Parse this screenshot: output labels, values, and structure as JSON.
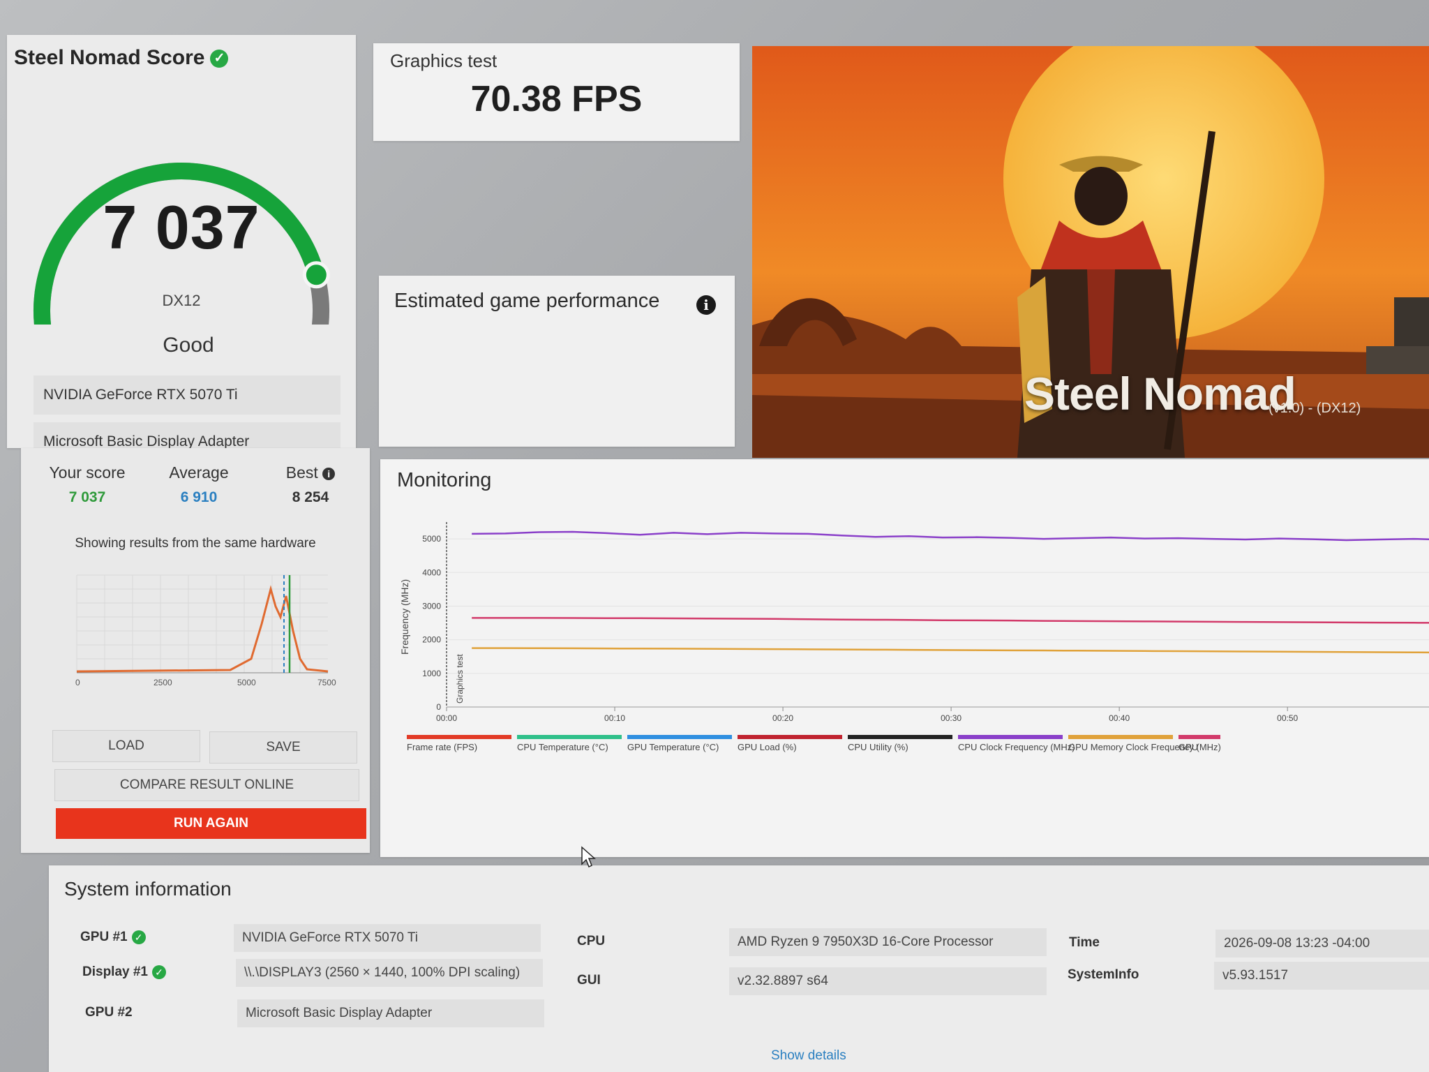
{
  "score": {
    "title": "Steel Nomad Score",
    "value": "7 037",
    "api": "DX12",
    "rating": "Good",
    "gauge_fraction": 0.86,
    "hardware": [
      "NVIDIA GeForce RTX 5070 Ti",
      "Microsoft Basic Display Adapter"
    ]
  },
  "compare": {
    "your_label": "Your score",
    "your_value": "7 037",
    "avg_label": "Average",
    "avg_value": "6 910",
    "best_label": "Best",
    "best_value": "8 254",
    "note": "Showing results from the same hardware",
    "axis_ticks": [
      "0",
      "2500",
      "5000",
      "7500"
    ]
  },
  "buttons": {
    "load": "LOAD",
    "save": "SAVE",
    "compare": "COMPARE RESULT ONLINE",
    "run_again": "RUN AGAIN"
  },
  "graphics_test": {
    "label": "Graphics test",
    "value": "70.38 FPS"
  },
  "estimated": {
    "title": "Estimated game performance"
  },
  "hero": {
    "title": "Steel Nomad",
    "version": "(v1.0) - (DX12)"
  },
  "monitoring": {
    "title": "Monitoring",
    "y_axis_label": "Frequency (MHz)",
    "marker_label": "Graphics test",
    "y_ticks": [
      "0",
      "1000",
      "2000",
      "3000",
      "4000",
      "5000"
    ],
    "x_ticks": [
      "00:00",
      "00:10",
      "00:20",
      "00:30",
      "00:40",
      "00:50"
    ],
    "legend": [
      {
        "label": "Frame rate (FPS)",
        "color": "#e23a26"
      },
      {
        "label": "CPU Temperature (°C)",
        "color": "#2fc08a"
      },
      {
        "label": "GPU Temperature (°C)",
        "color": "#2f8fe0"
      },
      {
        "label": "GPU Load (%)",
        "color": "#c0232f"
      },
      {
        "label": "CPU Utility (%)",
        "color": "#222222"
      },
      {
        "label": "CPU Clock Frequency (MHz)",
        "color": "#8a3fc9"
      },
      {
        "label": "GPU Memory Clock Frequency (MHz)",
        "color": "#e0a23a"
      },
      {
        "label": "GPU",
        "color": "#d23a6a"
      }
    ]
  },
  "chart_data": {
    "type": "line",
    "xlabel": "",
    "ylabel": "Frequency (MHz)",
    "ylim": [
      0,
      5500
    ],
    "x": [
      0,
      2,
      4,
      6,
      8,
      10,
      12,
      14,
      16,
      18,
      20,
      22,
      24,
      26,
      28,
      30,
      32,
      34,
      36,
      38,
      40,
      42,
      44,
      46,
      48,
      50,
      52,
      54,
      56,
      58
    ],
    "series": [
      {
        "name": "CPU Clock Frequency (MHz)",
        "color": "#8a3fc9",
        "values": [
          5150,
          5160,
          5200,
          5210,
          5170,
          5120,
          5180,
          5140,
          5180,
          5160,
          5150,
          5100,
          5060,
          5080,
          5040,
          5050,
          5030,
          5000,
          5020,
          5040,
          5010,
          5020,
          5000,
          4980,
          5010,
          4990,
          4960,
          4980,
          5000,
          4970
        ]
      },
      {
        "name": "GPU Clock Frequency (MHz)",
        "color": "#d23a6a",
        "values": [
          2650,
          2650,
          2648,
          2645,
          2640,
          2640,
          2635,
          2630,
          2625,
          2620,
          2610,
          2600,
          2595,
          2590,
          2580,
          2575,
          2570,
          2560,
          2555,
          2550,
          2545,
          2540,
          2535,
          2530,
          2525,
          2520,
          2515,
          2510,
          2505,
          2500
        ]
      },
      {
        "name": "GPU Memory Clock Frequency (MHz)",
        "color": "#e0a23a",
        "values": [
          1750,
          1750,
          1748,
          1745,
          1740,
          1738,
          1735,
          1730,
          1725,
          1720,
          1715,
          1710,
          1705,
          1700,
          1695,
          1690,
          1685,
          1680,
          1675,
          1670,
          1665,
          1660,
          1655,
          1650,
          1645,
          1640,
          1635,
          1630,
          1625,
          1620
        ]
      }
    ]
  },
  "system": {
    "title": "System information",
    "gpu1_key": "GPU #1",
    "gpu1_val": "NVIDIA GeForce RTX 5070 Ti",
    "display1_key": "Display #1",
    "display1_val": "\\\\.\\DISPLAY3 (2560 × 1440, 100% DPI scaling)",
    "gpu2_key": "GPU #2",
    "gpu2_val": "Microsoft Basic Display Adapter",
    "cpu_key": "CPU",
    "cpu_val": "AMD Ryzen 9 7950X3D 16-Core Processor",
    "gui_key": "GUI",
    "gui_val": "v2.32.8897 s64",
    "time_key": "Time",
    "time_val": "2026-09-08 13:23 -04:00",
    "sysinfo_key": "SystemInfo",
    "sysinfo_val": "v5.93.1517",
    "show_details": "Show details"
  }
}
